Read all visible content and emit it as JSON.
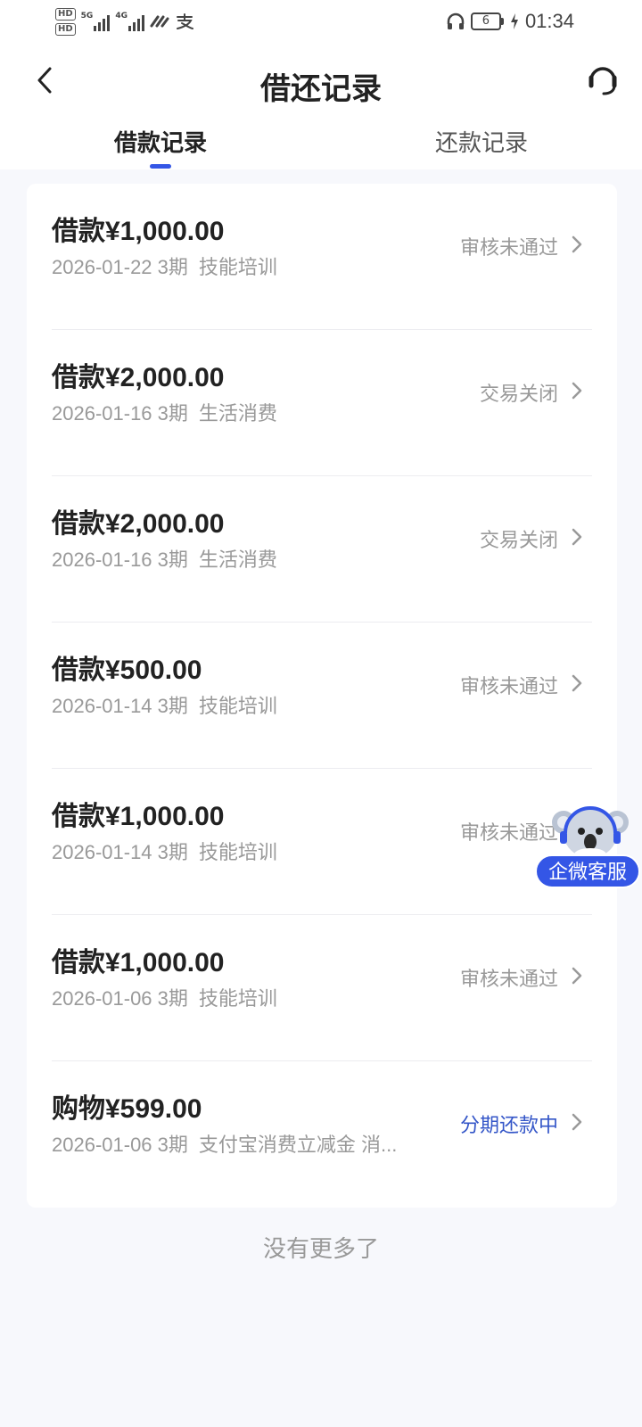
{
  "status_bar": {
    "hd1": "HD",
    "hd2": "HD",
    "net1": "5G",
    "net2": "4G",
    "battery_level": "6",
    "time": "01:34"
  },
  "header": {
    "title": "借还记录"
  },
  "tabs": [
    {
      "label": "借款记录",
      "active": true
    },
    {
      "label": "还款记录",
      "active": false
    }
  ],
  "records": [
    {
      "amount": "借款¥1,000.00",
      "date": "2026-01-22",
      "periods": "3期",
      "purpose": "技能培训",
      "status": "审核未通过"
    },
    {
      "amount": "借款¥2,000.00",
      "date": "2026-01-16",
      "periods": "3期",
      "purpose": "生活消费",
      "status": "交易关闭"
    },
    {
      "amount": "借款¥2,000.00",
      "date": "2026-01-16",
      "periods": "3期",
      "purpose": "生活消费",
      "status": "交易关闭"
    },
    {
      "amount": "借款¥500.00",
      "date": "2026-01-14",
      "periods": "3期",
      "purpose": "技能培训",
      "status": "审核未通过"
    },
    {
      "amount": "借款¥1,000.00",
      "date": "2026-01-14",
      "periods": "3期",
      "purpose": "技能培训",
      "status": "审核未通过"
    },
    {
      "amount": "借款¥1,000.00",
      "date": "2026-01-06",
      "periods": "3期",
      "purpose": "技能培训",
      "status": "审核未通过"
    },
    {
      "amount": "购物¥599.00",
      "date": "2026-01-06",
      "periods": "3期",
      "purpose": "支付宝消费立减金 消...",
      "status": "分期还款中"
    }
  ],
  "footer": {
    "no_more": "没有更多了"
  },
  "floating_service": {
    "label": "企微客服"
  },
  "colors": {
    "accent": "#3456e6",
    "status_blue": "#3456c8",
    "muted": "#999999"
  }
}
